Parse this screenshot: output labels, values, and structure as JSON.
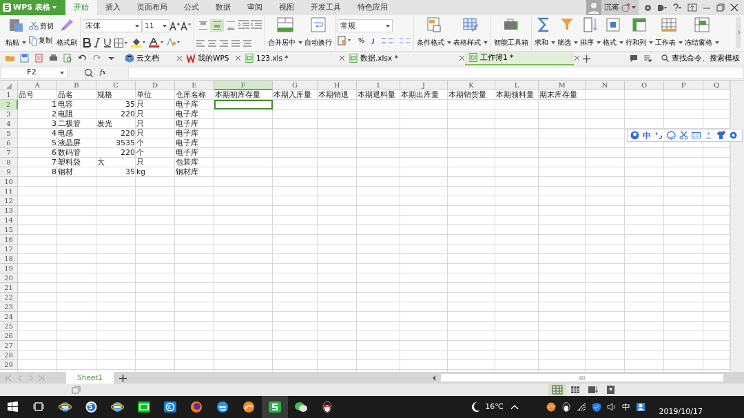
{
  "app": {
    "title": "WPS 表格"
  },
  "menu_tabs": [
    {
      "label": "开始",
      "selected": true
    },
    {
      "label": "插入",
      "selected": false
    },
    {
      "label": "页面布局",
      "selected": false
    },
    {
      "label": "公式",
      "selected": false
    },
    {
      "label": "数据",
      "selected": false
    },
    {
      "label": "审阅",
      "selected": false
    },
    {
      "label": "视图",
      "selected": false
    },
    {
      "label": "开发工具",
      "selected": false
    },
    {
      "label": "特色应用",
      "selected": false
    }
  ],
  "user": {
    "name": "沉蒋"
  },
  "ribbon": {
    "clipboard": {
      "paste": "粘贴",
      "cut": "剪切",
      "copy": "复制",
      "format_painter": "格式刷"
    },
    "font": {
      "name": "宋体",
      "size": "11"
    },
    "vertical_align": [
      {
        "selected": false
      },
      {
        "selected": true
      },
      {
        "selected": false
      }
    ],
    "merge": "合并居中",
    "wrap": "自动换行",
    "number_format": "常规",
    "percent": "%",
    "tools": [
      {
        "label": "条件格式",
        "dropdown": true
      },
      {
        "label": "表格样式",
        "dropdown": true
      },
      {
        "label": "智能工具箱",
        "dropdown": false
      },
      {
        "label": "求和",
        "dropdown": true
      },
      {
        "label": "筛选",
        "dropdown": true
      },
      {
        "label": "排序",
        "dropdown": true
      },
      {
        "label": "格式",
        "dropdown": true
      },
      {
        "label": "行和列",
        "dropdown": true
      },
      {
        "label": "工作表",
        "dropdown": true
      },
      {
        "label": "冻结窗格",
        "dropdown": true
      }
    ]
  },
  "doc_tabs": [
    {
      "label": "云文档",
      "kind": "cloud",
      "selected": false
    },
    {
      "label": "我的WPS",
      "kind": "wps",
      "selected": false
    },
    {
      "label": "123.xls *",
      "kind": "sheet",
      "selected": false
    },
    {
      "label": "数据.xlsx *",
      "kind": "sheet",
      "selected": false
    },
    {
      "label": "工作簿1 *",
      "kind": "sheet",
      "selected": true
    }
  ],
  "search": {
    "label": "查找命令、搜索模板"
  },
  "formula_bar": {
    "name_box": "F2",
    "fx": "fx"
  },
  "sheet": {
    "columns": [
      {
        "label": "A",
        "selected": false
      },
      {
        "label": "B",
        "selected": false
      },
      {
        "label": "C",
        "selected": false
      },
      {
        "label": "D",
        "selected": false
      },
      {
        "label": "E",
        "selected": false
      },
      {
        "label": "F",
        "selected": true
      },
      {
        "label": "G",
        "selected": false
      },
      {
        "label": "H",
        "selected": false
      },
      {
        "label": "I",
        "selected": false
      },
      {
        "label": "J",
        "selected": false
      },
      {
        "label": "K",
        "selected": false
      },
      {
        "label": "L",
        "selected": false
      },
      {
        "label": "M",
        "selected": false
      },
      {
        "label": "N",
        "selected": false
      },
      {
        "label": "O",
        "selected": false
      },
      {
        "label": "P",
        "selected": false
      },
      {
        "label": "Q",
        "selected": false
      }
    ],
    "rows": [
      {
        "label": "1",
        "selected": false,
        "cells": [
          {
            "text": "品号",
            "kind": "text"
          },
          {
            "text": "品名",
            "kind": "text"
          },
          {
            "text": "规格",
            "kind": "text"
          },
          {
            "text": "单位",
            "kind": "text"
          },
          {
            "text": "仓库名称",
            "kind": "text"
          },
          {
            "text": "本期初库存量",
            "kind": "text"
          },
          {
            "text": "本期入库量",
            "kind": "text"
          },
          {
            "text": "本期销退",
            "kind": "text"
          },
          {
            "text": "本期退料量",
            "kind": "text"
          },
          {
            "text": "本期出库量",
            "kind": "text"
          },
          {
            "text": "本期销货量",
            "kind": "text"
          },
          {
            "text": "本期领料量",
            "kind": "text"
          },
          {
            "text": "期末库存量",
            "kind": "text"
          }
        ]
      },
      {
        "label": "2",
        "selected": true,
        "cells": [
          {
            "text": "1",
            "kind": "number"
          },
          {
            "text": "电容",
            "kind": "text"
          },
          {
            "text": "35",
            "kind": "number"
          },
          {
            "text": "只",
            "kind": "text"
          },
          {
            "text": "电子库",
            "kind": "text"
          }
        ]
      },
      {
        "label": "3",
        "selected": false,
        "cells": [
          {
            "text": "2",
            "kind": "number"
          },
          {
            "text": "电阻",
            "kind": "text"
          },
          {
            "text": "220",
            "kind": "number"
          },
          {
            "text": "只",
            "kind": "text"
          },
          {
            "text": "电子库",
            "kind": "text"
          }
        ]
      },
      {
        "label": "4",
        "selected": false,
        "cells": [
          {
            "text": "3",
            "kind": "number"
          },
          {
            "text": "二极管",
            "kind": "text"
          },
          {
            "text": "发光",
            "kind": "text"
          },
          {
            "text": "只",
            "kind": "text"
          },
          {
            "text": "电子库",
            "kind": "text"
          }
        ]
      },
      {
        "label": "5",
        "selected": false,
        "cells": [
          {
            "text": "4",
            "kind": "number"
          },
          {
            "text": "电感",
            "kind": "text"
          },
          {
            "text": "220",
            "kind": "number"
          },
          {
            "text": "只",
            "kind": "text"
          },
          {
            "text": "电子库",
            "kind": "text"
          }
        ]
      },
      {
        "label": "6",
        "selected": false,
        "cells": [
          {
            "text": "5",
            "kind": "number"
          },
          {
            "text": "液晶屏",
            "kind": "text"
          },
          {
            "text": "3535",
            "kind": "number"
          },
          {
            "text": "个",
            "kind": "text"
          },
          {
            "text": "电子库",
            "kind": "text"
          }
        ]
      },
      {
        "label": "7",
        "selected": false,
        "cells": [
          {
            "text": "6",
            "kind": "number"
          },
          {
            "text": "数码管",
            "kind": "text"
          },
          {
            "text": "220",
            "kind": "number"
          },
          {
            "text": "个",
            "kind": "text"
          },
          {
            "text": "电子库",
            "kind": "text"
          }
        ]
      },
      {
        "label": "8",
        "selected": false,
        "cells": [
          {
            "text": "7",
            "kind": "number"
          },
          {
            "text": "塑料袋",
            "kind": "text"
          },
          {
            "text": "大",
            "kind": "text"
          },
          {
            "text": "只",
            "kind": "text"
          },
          {
            "text": "包装库",
            "kind": "text"
          }
        ]
      },
      {
        "label": "9",
        "selected": false,
        "cells": [
          {
            "text": "8",
            "kind": "number"
          },
          {
            "text": "钢材",
            "kind": "text"
          },
          {
            "text": "35",
            "kind": "number"
          },
          {
            "text": "kg",
            "kind": "text"
          },
          {
            "text": "钢材库",
            "kind": "text"
          }
        ]
      },
      {
        "label": "10",
        "selected": false
      },
      {
        "label": "11",
        "selected": false
      },
      {
        "label": "12",
        "selected": false
      },
      {
        "label": "13",
        "selected": false
      },
      {
        "label": "14",
        "selected": false
      },
      {
        "label": "15",
        "selected": false
      },
      {
        "label": "16",
        "selected": false
      },
      {
        "label": "17",
        "selected": false
      },
      {
        "label": "18",
        "selected": false
      },
      {
        "label": "19",
        "selected": false
      },
      {
        "label": "20",
        "selected": false
      },
      {
        "label": "21",
        "selected": false
      },
      {
        "label": "22",
        "selected": false
      },
      {
        "label": "23",
        "selected": false
      },
      {
        "label": "24",
        "selected": false
      },
      {
        "label": "25",
        "selected": false
      },
      {
        "label": "26",
        "selected": false
      },
      {
        "label": "27",
        "selected": false
      },
      {
        "label": "28",
        "selected": false
      },
      {
        "label": "29",
        "selected": false
      }
    ]
  },
  "sheet_tabs": [
    {
      "label": "Sheet1",
      "selected": true
    }
  ],
  "view_modes": [
    {
      "selected": true
    },
    {
      "selected": false
    },
    {
      "selected": false
    },
    {
      "selected": false
    }
  ],
  "ime_bar": {
    "label": "中"
  },
  "taskbar": {
    "weather": "16℃",
    "input_method": "中",
    "date": "2019/10/17"
  }
}
